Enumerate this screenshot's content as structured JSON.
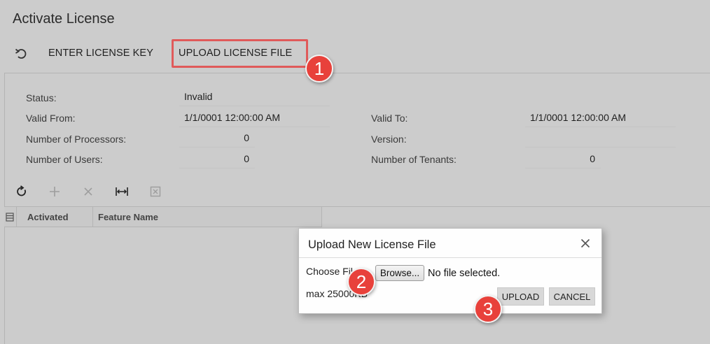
{
  "page": {
    "title": "Activate License"
  },
  "toolbar": {
    "undo_icon": "undo-icon",
    "enter_key_label": "ENTER LICENSE KEY",
    "upload_file_label": "UPLOAD LICENSE FILE"
  },
  "annotations": {
    "badge1": "1",
    "badge2": "2",
    "badge3": "3",
    "highlight_color": "#e05a5a",
    "badge_color": "#e8413b"
  },
  "license": {
    "status_label": "Status:",
    "status_value": "Invalid",
    "valid_from_label": "Valid From:",
    "valid_from_value": "1/1/0001 12:00:00 AM",
    "valid_to_label": "Valid To:",
    "valid_to_value": "1/1/0001 12:00:00 AM",
    "processors_label": "Number of Processors:",
    "processors_value": "0",
    "version_label": "Version:",
    "version_value": "",
    "users_label": "Number of Users:",
    "users_value": "0",
    "tenants_label": "Number of Tenants:",
    "tenants_value": "0"
  },
  "grid": {
    "toolbar_icons": [
      "refresh-icon",
      "add-icon",
      "delete-icon",
      "fit-columns-icon",
      "export-excel-icon"
    ],
    "columns": [
      "Activated",
      "Feature Name"
    ]
  },
  "dialog": {
    "title": "Upload New License File",
    "choose_file_label": "Choose File",
    "browse_label": "Browse...",
    "file_status": "No file selected.",
    "max_size": "max 25000KB",
    "upload_label": "UPLOAD",
    "cancel_label": "CANCEL"
  }
}
